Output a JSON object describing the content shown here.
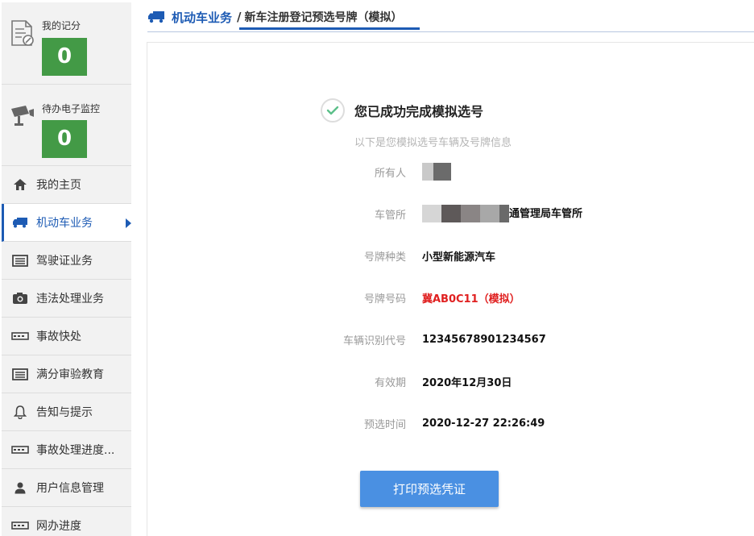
{
  "sidebar": {
    "score": {
      "label": "我的记分",
      "value": "0"
    },
    "monitor": {
      "label": "待办电子监控",
      "value": "0"
    },
    "items": [
      {
        "label": "我的主页",
        "icon": "home-icon"
      },
      {
        "label": "机动车业务",
        "icon": "truck-icon",
        "active": true
      },
      {
        "label": "驾驶证业务",
        "icon": "card-icon"
      },
      {
        "label": "违法处理业务",
        "icon": "camera-icon"
      },
      {
        "label": "事故快处",
        "icon": "car-accident-icon"
      },
      {
        "label": "满分审验教育",
        "icon": "list-icon"
      },
      {
        "label": "告知与提示",
        "icon": "bell-icon"
      },
      {
        "label": "事故处理进度...",
        "icon": "car-accident-icon"
      },
      {
        "label": "用户信息管理",
        "icon": "user-icon"
      },
      {
        "label": "网办进度",
        "icon": "car-accident-icon"
      }
    ]
  },
  "breadcrumb": {
    "section": "机动车业务",
    "separator": "/",
    "page": "新车注册登记预选号牌（模拟）"
  },
  "result": {
    "title": "您已成功完成模拟选号",
    "subtitle": "以下是您模拟选号车辆及号牌信息",
    "fields": {
      "owner": {
        "label": "所有人",
        "value": ""
      },
      "office": {
        "label": "车管所",
        "value": "通管理局车管所"
      },
      "plate_type": {
        "label": "号牌种类",
        "value": "小型新能源汽车"
      },
      "plate_number": {
        "label": "号牌号码",
        "value": "冀AB0C11（模拟）"
      },
      "vin": {
        "label": "车辆识别代号",
        "value": "12345678901234567"
      },
      "valid_until": {
        "label": "有效期",
        "value": "2020年12月30日"
      },
      "select_time": {
        "label": "预选时间",
        "value": "2020-12-27 22:26:49"
      }
    },
    "print_button": "打印预选凭证"
  },
  "colors": {
    "accent": "#1d5bb4",
    "tile_green": "#439a46",
    "button_blue": "#4a90e2",
    "plate_red": "#e02020"
  }
}
